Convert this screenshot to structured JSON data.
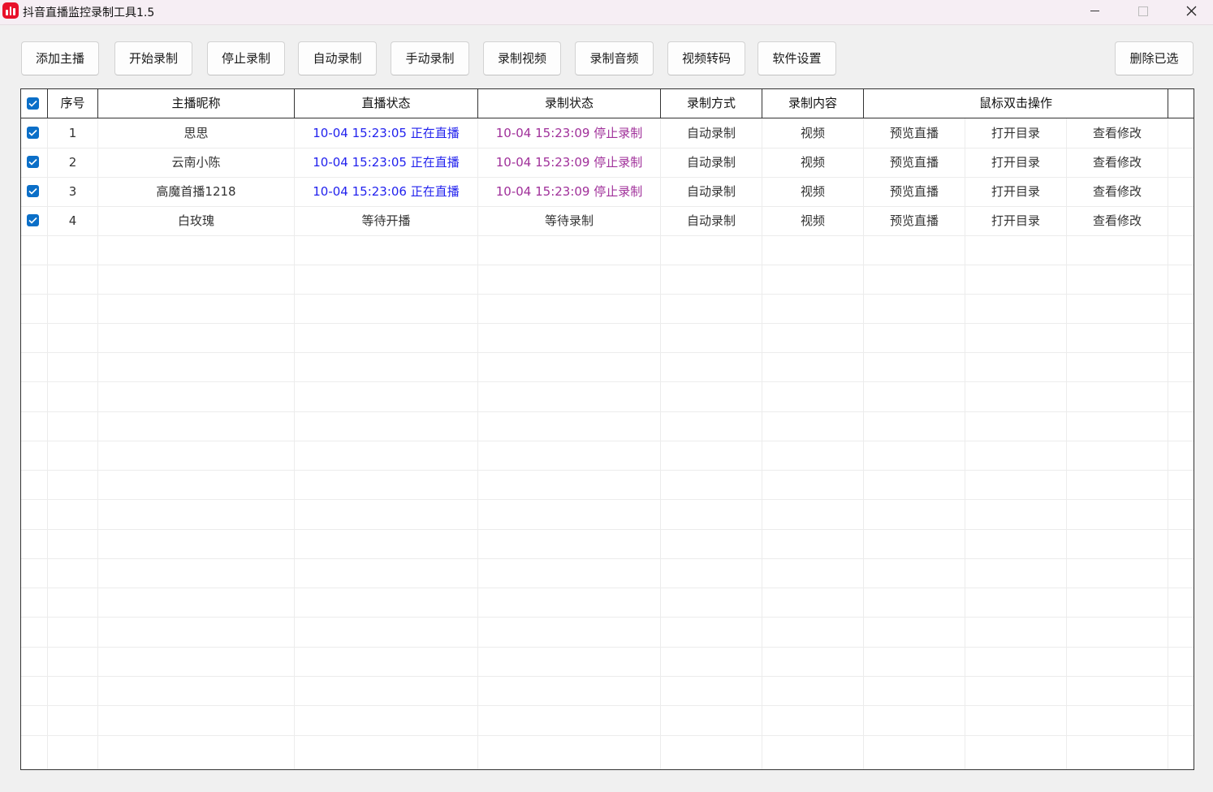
{
  "window": {
    "title": "抖音直播监控录制工具1.5"
  },
  "toolbar": {
    "add_anchor": "添加主播",
    "start_record": "开始录制",
    "stop_record": "停止录制",
    "auto_record": "自动录制",
    "manual_record": "手动录制",
    "record_video": "录制视频",
    "record_audio": "录制音频",
    "video_transcode": "视频转码",
    "settings": "软件设置",
    "delete_selected": "删除已选"
  },
  "table": {
    "headers": {
      "index": "序号",
      "nickname": "主播昵称",
      "live_status": "直播状态",
      "record_status": "录制状态",
      "record_mode": "录制方式",
      "record_content": "录制内容",
      "double_click_actions": "鼠标双击操作"
    },
    "rows": [
      {
        "checked": true,
        "index": "1",
        "nickname": "思思",
        "live_status": "10-04 15:23:05 正在直播",
        "record_status": "10-04 15:23:09 停止录制",
        "record_mode": "自动录制",
        "record_content": "视频",
        "preview": "预览直播",
        "open_dir": "打开目录",
        "view_edit": "查看修改"
      },
      {
        "checked": true,
        "index": "2",
        "nickname": "云南小陈",
        "live_status": "10-04 15:23:05 正在直播",
        "record_status": "10-04 15:23:09 停止录制",
        "record_mode": "自动录制",
        "record_content": "视频",
        "preview": "预览直播",
        "open_dir": "打开目录",
        "view_edit": "查看修改"
      },
      {
        "checked": true,
        "index": "3",
        "nickname": "高魔首播1218",
        "live_status": "10-04 15:23:06 正在直播",
        "record_status": "10-04 15:23:09 停止录制",
        "record_mode": "自动录制",
        "record_content": "视频",
        "preview": "预览直播",
        "open_dir": "打开目录",
        "view_edit": "查看修改"
      },
      {
        "checked": true,
        "index": "4",
        "nickname": "白玫瑰",
        "live_status": "等待开播",
        "record_status": "等待录制",
        "record_mode": "自动录制",
        "record_content": "视频",
        "preview": "预览直播",
        "open_dir": "打开目录",
        "view_edit": "查看修改"
      }
    ]
  },
  "colors": {
    "live": "#2222ee",
    "recording": "#a0309a",
    "checkbox": "#0b6fc8",
    "app_icon": "#e8102a"
  }
}
